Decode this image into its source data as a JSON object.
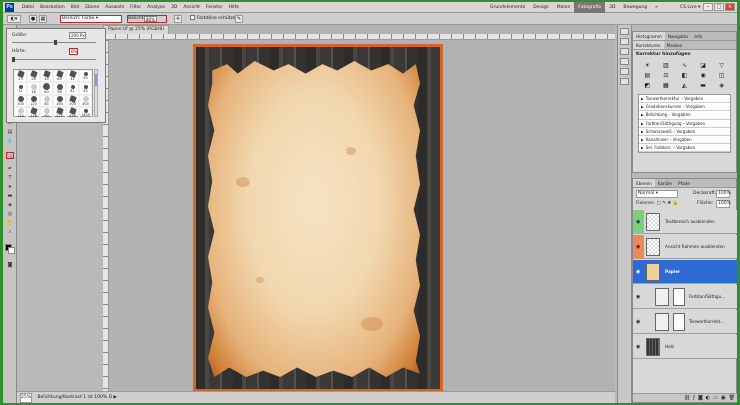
{
  "menubar": {
    "logo": "Ps",
    "items": [
      "Datei",
      "Bearbeiten",
      "Bild",
      "Ebene",
      "Auswahl",
      "Filter",
      "Analyse",
      "3D",
      "Ansicht",
      "Fenster",
      "Hilfe"
    ],
    "workspaces": [
      "Grundelemente",
      "Design",
      "Malen",
      "Fotografie",
      "3D",
      "Bewegung"
    ],
    "active_workspace": "Fotografie",
    "more": "»",
    "cslive": "CS Live ▾"
  },
  "options": {
    "brush_label": "Bereich:",
    "brush_value": "Farbe",
    "deck_label": "Belichtung:",
    "deck_value": "80%",
    "protect_label": "Farbtöne schützen"
  },
  "brush_popup": {
    "size_label": "Größe:",
    "size_value": "200 Px",
    "hardness_label": "Härte:",
    "hardness_value": "0%",
    "brushes": [
      "23",
      "26",
      "44",
      "60",
      "41",
      "95",
      "31",
      "18",
      "60",
      "56",
      "81",
      "45",
      "100",
      "120",
      "85",
      "160",
      "200",
      "300",
      "144",
      "116",
      "90",
      "270",
      "450",
      "1400"
    ]
  },
  "document": {
    "tab": "Papier.tif @ 25% (RGB/8)",
    "zoom": "25%",
    "status": "Belichtung/Kontrast 1 ist 100% D"
  },
  "adjust_panel": {
    "tabs": [
      "Histogramm",
      "Navigator",
      "Info"
    ],
    "tabs2": [
      "Korrekturen",
      "Masken"
    ],
    "title": "Korrektur hinzufügen",
    "presets": [
      "Tonwertkorrektur – Vorgaben",
      "Gradationskurven – Vorgaben",
      "Belichtung – Vorgaben",
      "Farbton/Sättigung – Vorgaben",
      "Schwarzweiß – Vorgaben",
      "Kanalmixer – Vorgaben",
      "Sel. Farbkorr. – Vorgaben"
    ]
  },
  "layers_panel": {
    "tabs": [
      "Ebenen",
      "Kanäle",
      "Pfade"
    ],
    "blend": "Normal",
    "opacity_label": "Deckkraft:",
    "opacity": "100%",
    "lock_label": "Fixieren:",
    "fill_label": "Fläche:",
    "fill": "100%",
    "layers": [
      "Textbereich ausblenden",
      "Ansicht Rahmen ausblenden",
      "Papier",
      "Farbton/Sättigu...",
      "Tonwertkorrekt...",
      "Holz"
    ]
  },
  "colors": {
    "highlight": "#d02020",
    "selected_layer": "#2f6ad3",
    "layer_green": "#7cd07c",
    "layer_orange": "#e88a5a",
    "frame": "#d5632a"
  }
}
